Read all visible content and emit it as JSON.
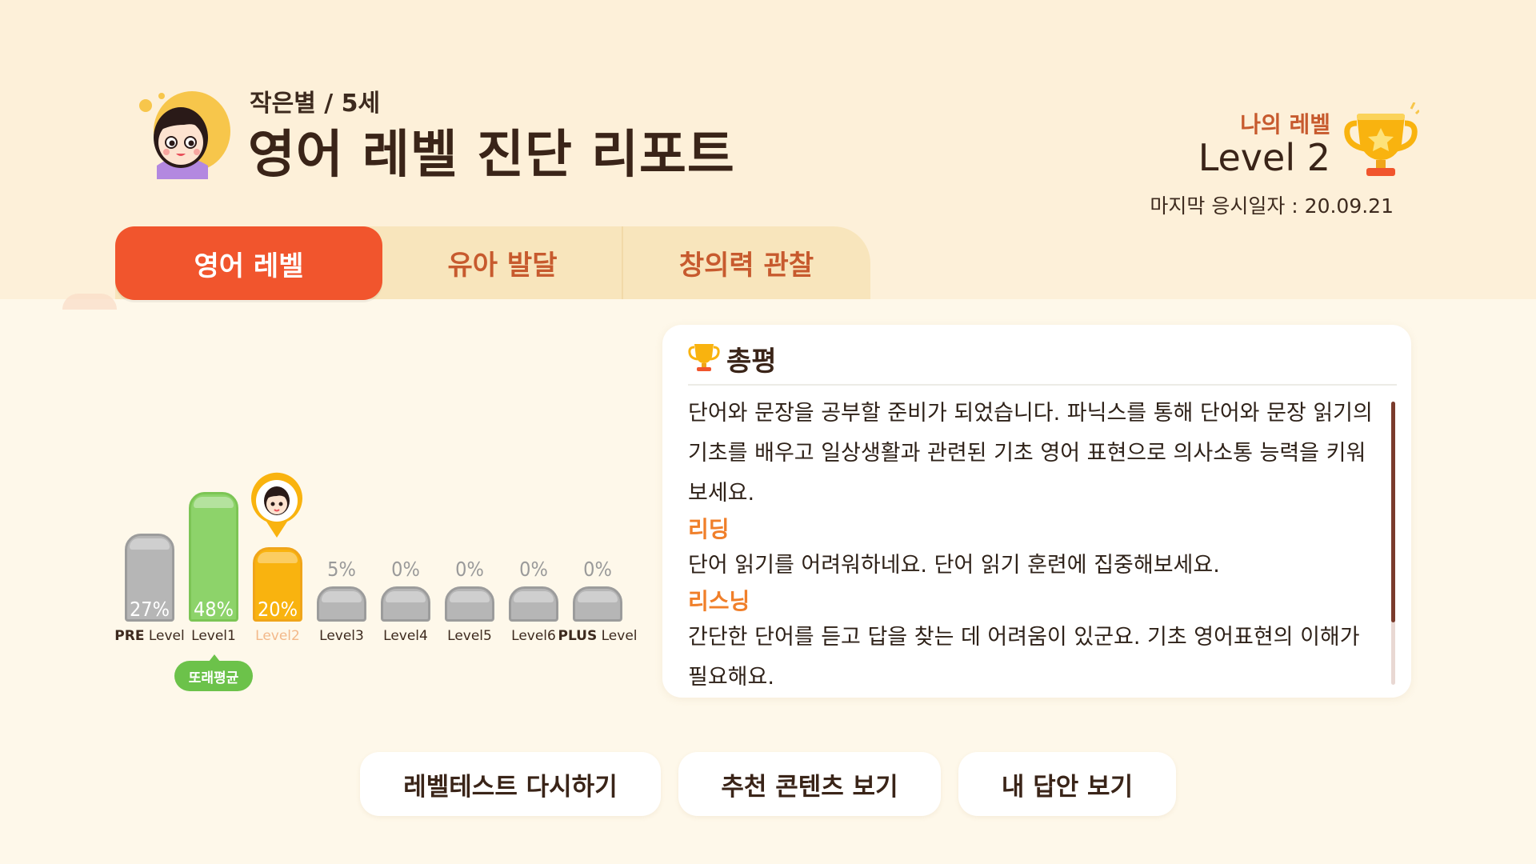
{
  "header": {
    "user_info": "작은별 / 5세",
    "title": "영어 레벨 진단 리포트",
    "my_level_label": "나의 레벨",
    "my_level_value": "Level 2",
    "last_test_date": "마지막 응시일자 : 20.09.21"
  },
  "tabs": [
    {
      "label": "영어 레벨",
      "active": true
    },
    {
      "label": "유아 발달",
      "active": false
    },
    {
      "label": "창의력 관찰",
      "active": false
    }
  ],
  "level_chart": {
    "bars": [
      {
        "label_prefix": "PRE",
        "label_suffix": "Level",
        "percent": "27%",
        "value": 27,
        "color": "#b6b6b6"
      },
      {
        "label_prefix": "",
        "label_suffix": "Level1",
        "percent": "48%",
        "value": 48,
        "color": "#8dd36a"
      },
      {
        "label_prefix": "",
        "label_suffix": "Level2",
        "percent": "20%",
        "value": 20,
        "color": "#f9b30f"
      },
      {
        "label_prefix": "",
        "label_suffix": "Level3",
        "percent": "5%",
        "value": 5,
        "color": "#b6b6b6"
      },
      {
        "label_prefix": "",
        "label_suffix": "Level4",
        "percent": "0%",
        "value": 0,
        "color": "#b6b6b6"
      },
      {
        "label_prefix": "",
        "label_suffix": "Level5",
        "percent": "0%",
        "value": 0,
        "color": "#b6b6b6"
      },
      {
        "label_prefix": "",
        "label_suffix": "Level6",
        "percent": "0%",
        "value": 0,
        "color": "#b6b6b6"
      },
      {
        "label_prefix": "PLUS",
        "label_suffix": "Level",
        "percent": "0%",
        "value": 0,
        "color": "#b6b6b6"
      }
    ],
    "avg_badge": "또래평균",
    "my_level_index": 2
  },
  "summary": {
    "title": "총평",
    "intro": "단어와 문장을 공부할 준비가 되었습니다. 파닉스를 통해 단어와 문장 읽기의 기초를 배우고 일상생활과 관련된 기초 영어 표현으로 의사소통 능력을 키워보세요.",
    "sections": [
      {
        "heading": "리딩",
        "text": "단어 읽기를 어려워하네요. 단어 읽기 훈련에 집중해보세요."
      },
      {
        "heading": "리스닝",
        "text": "간단한 단어를 듣고 답을 찾는 데 어려움이 있군요. 기초 영어표현의 이해가 필요해요."
      }
    ]
  },
  "buttons": {
    "retake": "레벨테스트 다시하기",
    "recommend": "추천 콘텐츠 보기",
    "my_answers": "내 답안 보기"
  },
  "colors": {
    "accent": "#f1552d",
    "tab_bg": "#f8e5bc",
    "level_green": "#8dd36a",
    "level_orange": "#f9b30f",
    "text_brown": "#3a2418",
    "section_orange": "#f07f2a"
  }
}
